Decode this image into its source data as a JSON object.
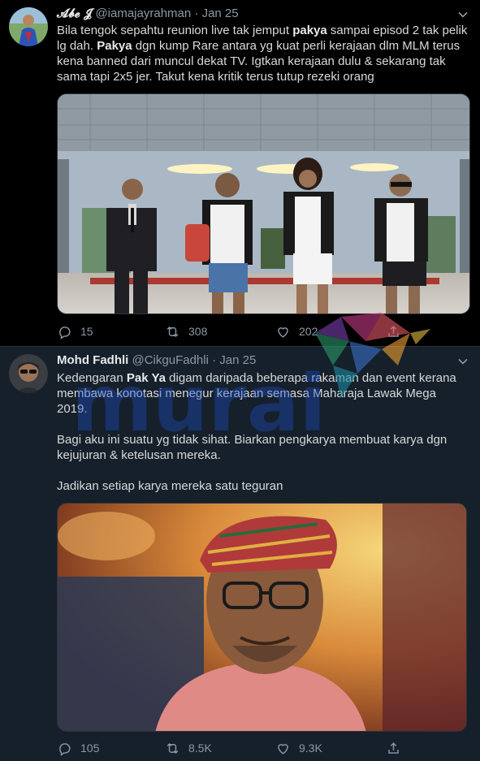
{
  "tweets": [
    {
      "display_name": "𝓐𝓫𝓮 𝓙",
      "handle": "@iamajayrahman",
      "dot": "·",
      "date": "Jan 25",
      "body_html": "Bila tengok sepahtu reunion live tak jemput <b>pakya</b> sampai episod 2 tak pelik lg dah. <b>Pakya</b> dgn kump Rare antara yg kuat perli kerajaan dlm MLM terus kena banned dari muncul dekat TV. Igtkan kerajaan dulu &amp; sekarang tak sama tapi 2x5 jer. Takut kena kritik terus tutup rezeki orang",
      "replies": "15",
      "retweets": "308",
      "likes": "202"
    },
    {
      "display_name": "Mohd Fadhli",
      "handle": "@CikguFadhli",
      "dot": "·",
      "date": "Jan 25",
      "body_html": "Kedengaran <b>Pak Ya</b> digam daripada beberapa rakaman dan event kerana membawa konotasi menegur  kerajaan semasa Maharaja Lawak Mega 2019.<br><br>Bagi aku ini suatu yg tidak sihat. Biarkan pengkarya membuat karya dgn kejujuran &amp; ketelusan mereka.<br><br>Jadikan setiap karya mereka satu teguran",
      "replies": "105",
      "retweets": "8.5K",
      "likes": "9.3K"
    }
  ],
  "watermark_text": "murai",
  "colors": {
    "tweet1_bg": "#000000",
    "tweet2_bg": "#15202b",
    "muted": "#8b98a5",
    "text": "#d9d9d9",
    "watermark": "#1e50c8"
  },
  "icons": [
    "reply-icon",
    "retweet-icon",
    "like-icon",
    "share-icon",
    "chevron-down-icon"
  ]
}
